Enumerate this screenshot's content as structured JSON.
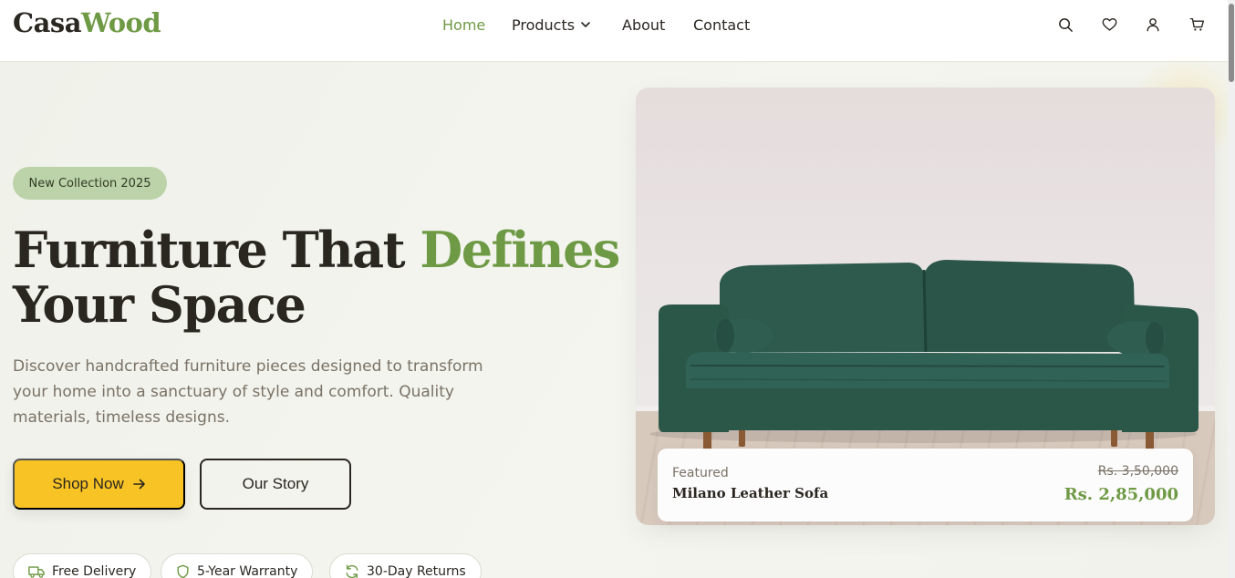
{
  "brand": {
    "part1": "Casa",
    "part2": "Wood"
  },
  "nav": {
    "home": "Home",
    "products": "Products",
    "about": "About",
    "contact": "Contact",
    "active": "Home"
  },
  "header_icons": [
    "search-icon",
    "heart-icon",
    "user-icon",
    "cart-icon"
  ],
  "hero": {
    "badge": "New Collection 2025",
    "title_line1": "Furniture That ",
    "title_accent": "Defines",
    "title_line2": "Your Space",
    "description": "Discover handcrafted furniture pieces designed to transform your home into a sanctuary of style and comfort. Quality materials, timeless designs.",
    "shop_button": "Shop Now",
    "story_button": "Our Story",
    "features": [
      "Free Delivery",
      "5-Year Warranty",
      "30-Day Returns"
    ]
  },
  "featured_product": {
    "label": "Featured",
    "name": "Milano Leather Sofa",
    "old_price": "Rs. 3,50,000",
    "price": "Rs. 2,85,000"
  },
  "colors": {
    "accent_green": "#6f9a45",
    "button_yellow": "#f8c324",
    "badge_green": "#bcd2a9",
    "dark_text": "#2a2620",
    "sofa_green": "#2f5b4f"
  }
}
